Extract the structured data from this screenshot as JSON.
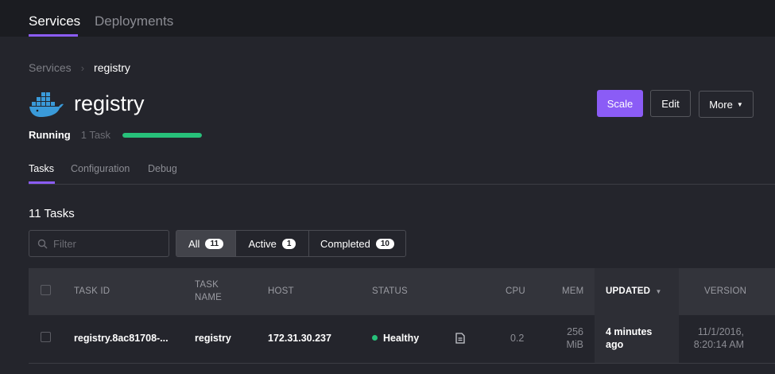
{
  "topnav": {
    "tabs": [
      "Services",
      "Deployments"
    ]
  },
  "breadcrumb": {
    "root": "Services",
    "separator": "›",
    "current": "registry"
  },
  "service": {
    "name": "registry",
    "icon": "docker-whale-icon",
    "status": "Running",
    "task_count": "1 Task",
    "health_progress": 1.0
  },
  "actions": {
    "scale": "Scale",
    "edit": "Edit",
    "more": "More"
  },
  "subtabs": [
    "Tasks",
    "Configuration",
    "Debug"
  ],
  "tasks": {
    "heading": "11 Tasks",
    "filter_placeholder": "Filter",
    "segments": [
      {
        "label": "All",
        "count": "11"
      },
      {
        "label": "Active",
        "count": "1"
      },
      {
        "label": "Completed",
        "count": "10"
      }
    ],
    "columns": {
      "task_id": "TASK ID",
      "task_name_1": "TASK",
      "task_name_2": "NAME",
      "host": "HOST",
      "status": "STATUS",
      "cpu": "CPU",
      "mem": "MEM",
      "updated": "UPDATED",
      "version": "VERSION"
    },
    "rows": [
      {
        "task_id": "registry.8ac81708-...",
        "task_name": "registry",
        "host": "172.31.30.237",
        "status": "Healthy",
        "cpu": "0.2",
        "mem_1": "256",
        "mem_2": "MiB",
        "updated_1": "4 minutes",
        "updated_2": "ago",
        "version_1": "11/1/2016,",
        "version_2": "8:20:14 AM"
      }
    ]
  },
  "colors": {
    "accent": "#8b5cf6",
    "healthy": "#27c17a",
    "background": "#24252c",
    "header": "#1b1c21"
  }
}
